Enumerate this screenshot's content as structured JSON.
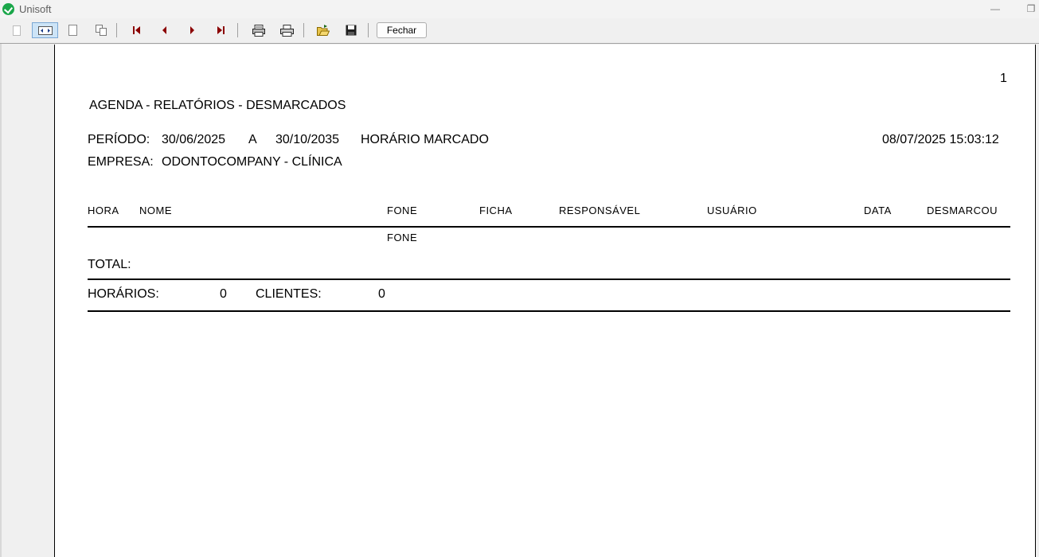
{
  "window": {
    "title": "Unisoft"
  },
  "toolbar": {
    "buttons": [
      {
        "name": "page-width-icon"
      },
      {
        "name": "fit-width-icon"
      },
      {
        "name": "whole-page-icon"
      },
      {
        "name": "multi-page-icon"
      },
      {
        "name": "first-page-icon"
      },
      {
        "name": "prev-page-icon"
      },
      {
        "name": "next-page-icon"
      },
      {
        "name": "last-page-icon"
      },
      {
        "name": "print-setup-icon"
      },
      {
        "name": "print-icon"
      },
      {
        "name": "open-icon"
      },
      {
        "name": "save-icon"
      }
    ],
    "close_label": "Fechar"
  },
  "report": {
    "page_number": "1",
    "title": "AGENDA - RELATÓRIOS - DESMARCADOS",
    "period_label": "PERÍODO:",
    "period_start": "30/06/2025",
    "period_sep": "A",
    "period_end": "30/10/2035",
    "schedule_type": "HORÁRIO MARCADO",
    "generated_at": "08/07/2025 15:03:12",
    "company_label": "EMPRESA:",
    "company_value": "ODONTOCOMPANY - CLÍNICA",
    "columns": {
      "hora": "HORA",
      "nome": "NOME",
      "fone": "FONE",
      "ficha": "FICHA",
      "responsavel": "RESPONSÁVEL",
      "usuario": "USUÁRIO",
      "data": "DATA",
      "desmarcou": "DESMARCOU"
    },
    "subheader_fone": "FONE",
    "total_label": "TOTAL:",
    "horarios_label": "HORÁRIOS:",
    "horarios_value": "0",
    "clientes_label": "CLIENTES:",
    "clientes_value": "0"
  },
  "colors": {
    "accent": "#1aa64a",
    "active_button": "#cde4f7",
    "arrow": "#8b0000"
  }
}
